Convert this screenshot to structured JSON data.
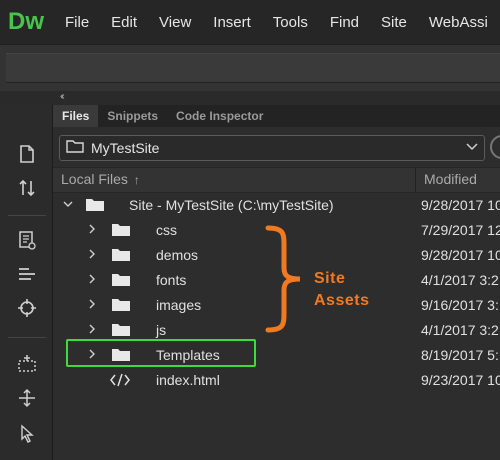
{
  "app": {
    "logo": "Dw"
  },
  "menu": [
    "File",
    "Edit",
    "View",
    "Insert",
    "Tools",
    "Find",
    "Site",
    "WebAssi"
  ],
  "collapse": {
    "arrow": "‹‹"
  },
  "panel": {
    "tabs": [
      "Files",
      "Snippets",
      "Code Inspector"
    ],
    "site_select": "MyTestSite",
    "columns": {
      "local": "Local Files",
      "local_arrow": "↑",
      "modified": "Modified"
    },
    "rows": [
      {
        "name": "Site - MyTestSite (C:\\myTestSite)",
        "modified": "9/28/2017 10",
        "type": "root"
      },
      {
        "name": "css",
        "modified": "7/29/2017 12",
        "type": "folder"
      },
      {
        "name": "demos",
        "modified": "9/28/2017 10",
        "type": "folder"
      },
      {
        "name": "fonts",
        "modified": "4/1/2017 3:2",
        "type": "folder"
      },
      {
        "name": "images",
        "modified": "9/16/2017 3:",
        "type": "folder"
      },
      {
        "name": "js",
        "modified": "4/1/2017 3:2",
        "type": "folder"
      },
      {
        "name": "Templates",
        "modified": "8/19/2017 5:",
        "type": "folder"
      },
      {
        "name": "index.html",
        "modified": "9/23/2017 10",
        "type": "file"
      }
    ]
  },
  "annotation": {
    "line1": "Site",
    "line2": "Assets",
    "color": "#f07a22",
    "highlight_color": "#3ddc3d"
  },
  "colors": {
    "logo": "#46c54a",
    "background": "#2b2b2b"
  }
}
